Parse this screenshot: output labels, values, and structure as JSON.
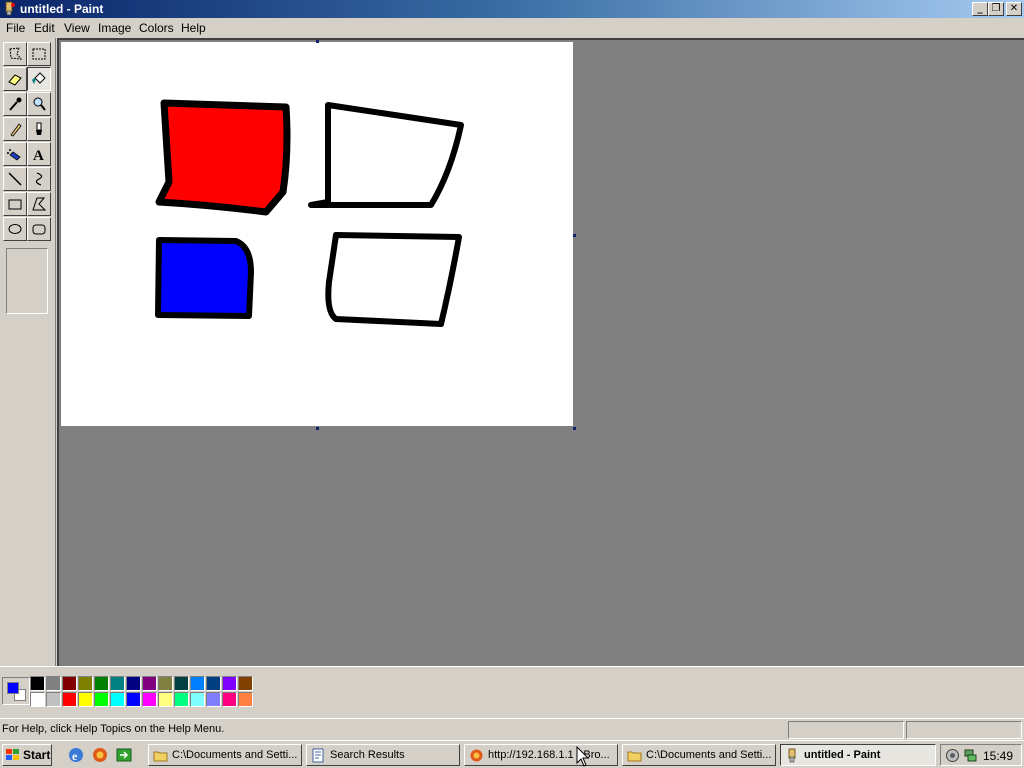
{
  "window": {
    "title": "untitled - Paint",
    "controls": {
      "minimize": "_",
      "restore": "❐",
      "close": "✕"
    }
  },
  "menu": {
    "items": [
      {
        "label": "File"
      },
      {
        "label": "Edit"
      },
      {
        "label": "View"
      },
      {
        "label": "Image"
      },
      {
        "label": "Colors"
      },
      {
        "label": "Help"
      }
    ]
  },
  "toolbox": {
    "tools": [
      {
        "name": "free-form-select-icon"
      },
      {
        "name": "select-icon"
      },
      {
        "name": "eraser-icon"
      },
      {
        "name": "fill-with-color-icon",
        "selected": true
      },
      {
        "name": "pick-color-icon"
      },
      {
        "name": "magnifier-icon"
      },
      {
        "name": "pencil-icon"
      },
      {
        "name": "brush-icon"
      },
      {
        "name": "airbrush-icon"
      },
      {
        "name": "text-icon",
        "glyph": "A"
      },
      {
        "name": "line-icon"
      },
      {
        "name": "curve-icon"
      },
      {
        "name": "rectangle-icon"
      },
      {
        "name": "polygon-icon"
      },
      {
        "name": "ellipse-icon"
      },
      {
        "name": "rounded-rectangle-icon"
      }
    ]
  },
  "canvas": {
    "background": "#ffffff",
    "shapes": [
      {
        "name": "red-filled-shape",
        "fill": "#ff0000",
        "stroke": "#000000"
      },
      {
        "name": "white-outlined-quad-top",
        "fill": "none",
        "stroke": "#000000"
      },
      {
        "name": "blue-filled-shape",
        "fill": "#0000ff",
        "stroke": "#000000"
      },
      {
        "name": "white-outlined-quad-bottom",
        "fill": "none",
        "stroke": "#000000"
      }
    ]
  },
  "palette": {
    "foreground": "#0000ff",
    "background": "#ffffff",
    "top_row": [
      "#000000",
      "#808080",
      "#800000",
      "#808000",
      "#008000",
      "#008080",
      "#000080",
      "#800080",
      "#808040",
      "#004040",
      "#0080ff",
      "#004080",
      "#8000ff",
      "#804000"
    ],
    "bottom_row": [
      "#ffffff",
      "#c0c0c0",
      "#ff0000",
      "#ffff00",
      "#00ff00",
      "#00ffff",
      "#0000ff",
      "#ff00ff",
      "#ffff80",
      "#00ff80",
      "#80ffff",
      "#8080ff",
      "#ff0080",
      "#ff8040"
    ]
  },
  "statusbar": {
    "help_text": "For Help, click Help Topics on the Help Menu.",
    "position": "",
    "size": ""
  },
  "taskbar": {
    "start_label": "Start",
    "quick_launch": [
      "ie-icon",
      "firefox-icon",
      "show-desktop-icon"
    ],
    "tasks": [
      {
        "label": "C:\\Documents and Setti...",
        "icon": "folder-icon"
      },
      {
        "label": "Search Results",
        "icon": "search-results-icon"
      },
      {
        "label": "http://192.168.1.1 - Bro...",
        "icon": "firefox-icon"
      },
      {
        "label": "C:\\Documents and Setti...",
        "icon": "folder-icon"
      },
      {
        "label": "untitled - Paint",
        "icon": "paint-icon",
        "active": true
      }
    ],
    "clock": "15:49"
  }
}
